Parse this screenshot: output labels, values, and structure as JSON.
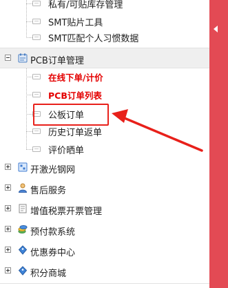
{
  "tree": {
    "top_items": [
      {
        "label": "私有/可贴库存管理"
      },
      {
        "label": "SMT贴片工具"
      },
      {
        "label": "SMT匹配个人习惯数据"
      }
    ],
    "pcb_group": {
      "label": "PCB订单管理",
      "items": [
        {
          "label": "在线下单/计价"
        },
        {
          "label": "PCB订单列表"
        },
        {
          "label": "公板订单"
        },
        {
          "label": "历史订单返单"
        },
        {
          "label": "评价晒单"
        }
      ]
    },
    "groups": [
      {
        "label": "开激光钢网"
      },
      {
        "label": "售后服务"
      },
      {
        "label": "增值税票开票管理"
      },
      {
        "label": "预付款系统"
      },
      {
        "label": "优惠券中心"
      },
      {
        "label": "积分商城"
      }
    ]
  },
  "colors": {
    "accent": "#e34a54",
    "annotation": "#e8201a",
    "link_red": "#e40000"
  }
}
